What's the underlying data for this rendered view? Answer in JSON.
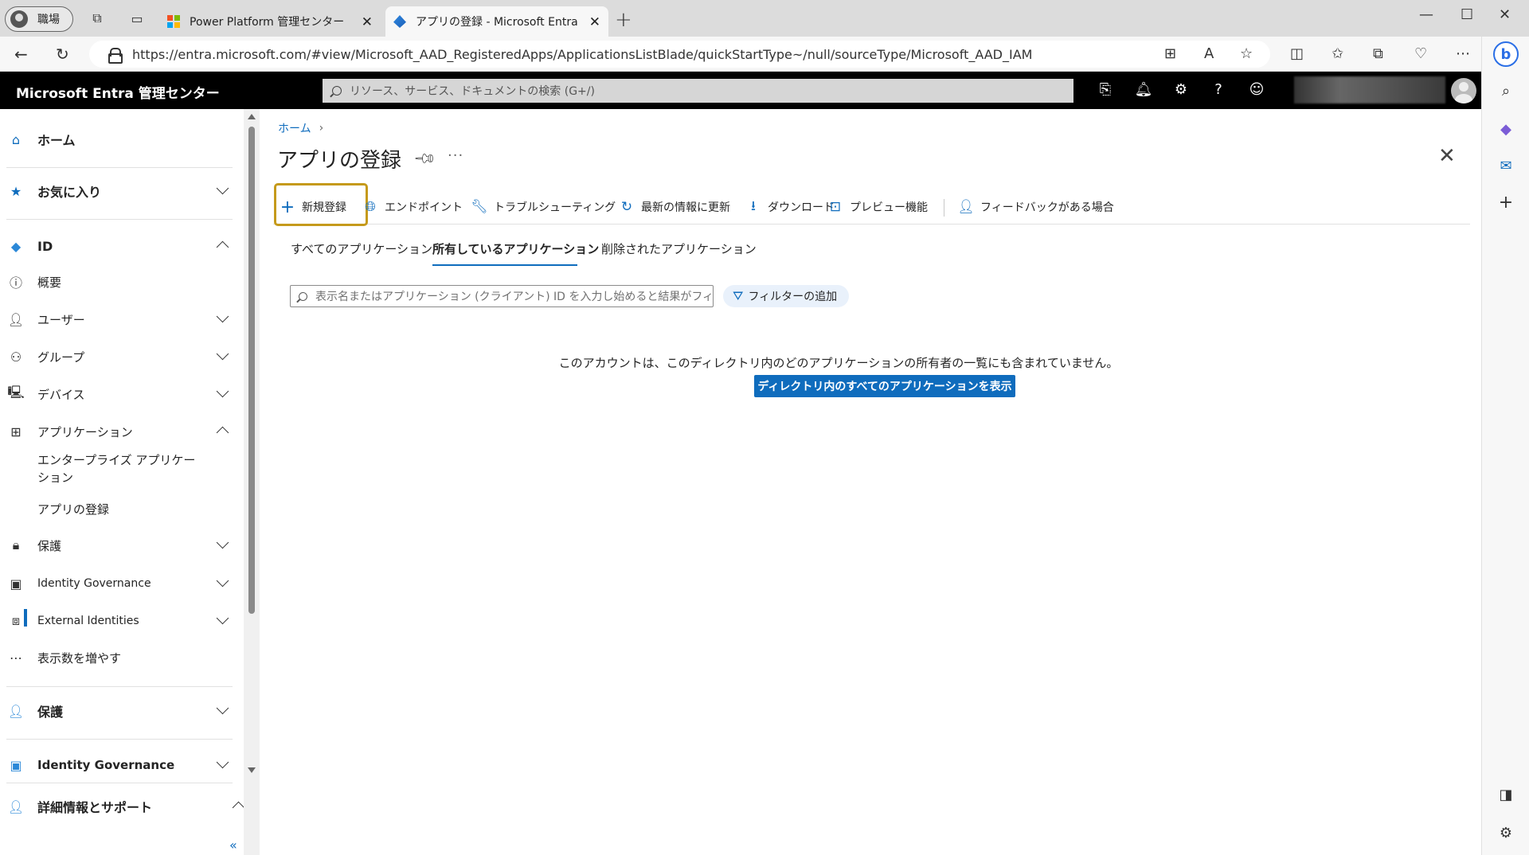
{
  "browser": {
    "profile_label": "職場",
    "tabs": [
      {
        "title": "Power Platform 管理センター",
        "active": false
      },
      {
        "title": "アプリの登録 - Microsoft Entra 管",
        "active": true
      }
    ],
    "url": "https://entra.microsoft.com/#view/Microsoft_AAD_RegisteredApps/ApplicationsListBlade/quickStartType~/null/sourceType/Microsoft_AAD_IAM"
  },
  "header": {
    "title": "Microsoft Entra 管理センター",
    "search_placeholder": "リソース、サービス、ドキュメントの検索 (G+/)"
  },
  "sidebar": {
    "home": "ホーム",
    "favorites": "お気に入り",
    "id_section": "ID",
    "items": {
      "overview": "概要",
      "users": "ユーザー",
      "groups": "グループ",
      "devices": "デバイス",
      "applications": "アプリケーション",
      "enterprise_apps": "エンタープライズ アプリケー",
      "enterprise_apps_2": "ション",
      "app_registrations": "アプリの登録",
      "protection": "保護",
      "identity_governance": "Identity Governance",
      "external_identities": "External Identities",
      "show_more": "表示数を増やす"
    },
    "protection_section": "保護",
    "governance_section": "Identity Governance",
    "support_section": "詳細情報とサポート",
    "collapse_glyph": "«"
  },
  "main": {
    "breadcrumb_home": "ホーム",
    "title": "アプリの登録",
    "commands": {
      "new_registration": "新規登録",
      "endpoints": "エンドポイント",
      "troubleshooting": "トラブルシューティング",
      "refresh": "最新の情報に更新",
      "download": "ダウンロード",
      "preview": "プレビュー機能",
      "feedback": "フィードバックがある場合"
    },
    "tabs": {
      "all": "すべてのアプリケーション",
      "owned": "所有しているアプリケーション",
      "deleted": "削除されたアプリケーション"
    },
    "filter_placeholder": "表示名またはアプリケーション (クライアント) ID を入力し始めると結果がフィル...",
    "add_filter": "フィルターの追加",
    "empty_message": "このアカウントは、このディレクトリ内のどのアプリケーションの所有者の一覧にも含まれていません。",
    "show_all_button": "ディレクトリ内のすべてのアプリケーションを表示"
  },
  "colors": {
    "accent": "#0f6cbd",
    "highlight": "#c59a1b"
  }
}
